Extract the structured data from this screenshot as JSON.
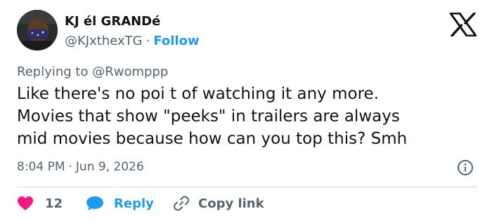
{
  "author": {
    "display_name": "KJ él GRANDé",
    "handle": "@KJxthexTG",
    "separator": "·",
    "follow_label": "Follow"
  },
  "reply_context": {
    "prefix": "Replying to",
    "mention": "@Rwomppp"
  },
  "tweet": {
    "text_lines": [
      "Like there's no poi t of watching it any more.",
      "Movies that show \"peeks\" in trailers are always",
      "mid movies because how can you top this? Smh"
    ]
  },
  "meta": {
    "time": "8:04 PM",
    "separator": "·",
    "date": "Jun 9, 2026"
  },
  "actions": {
    "like_count": "12",
    "reply_label": "Reply",
    "copy_label": "Copy link"
  },
  "icons": {
    "platform_logo": "x-logo-icon",
    "info": "info-icon",
    "like": "heart-icon",
    "reply": "speech-bubble-icon",
    "copy": "link-icon"
  },
  "colors": {
    "text_primary": "#0f1419",
    "text_secondary": "#536471",
    "accent_blue": "#1d9bf0",
    "like_pink": "#f91880",
    "divider": "#cfd9de"
  }
}
